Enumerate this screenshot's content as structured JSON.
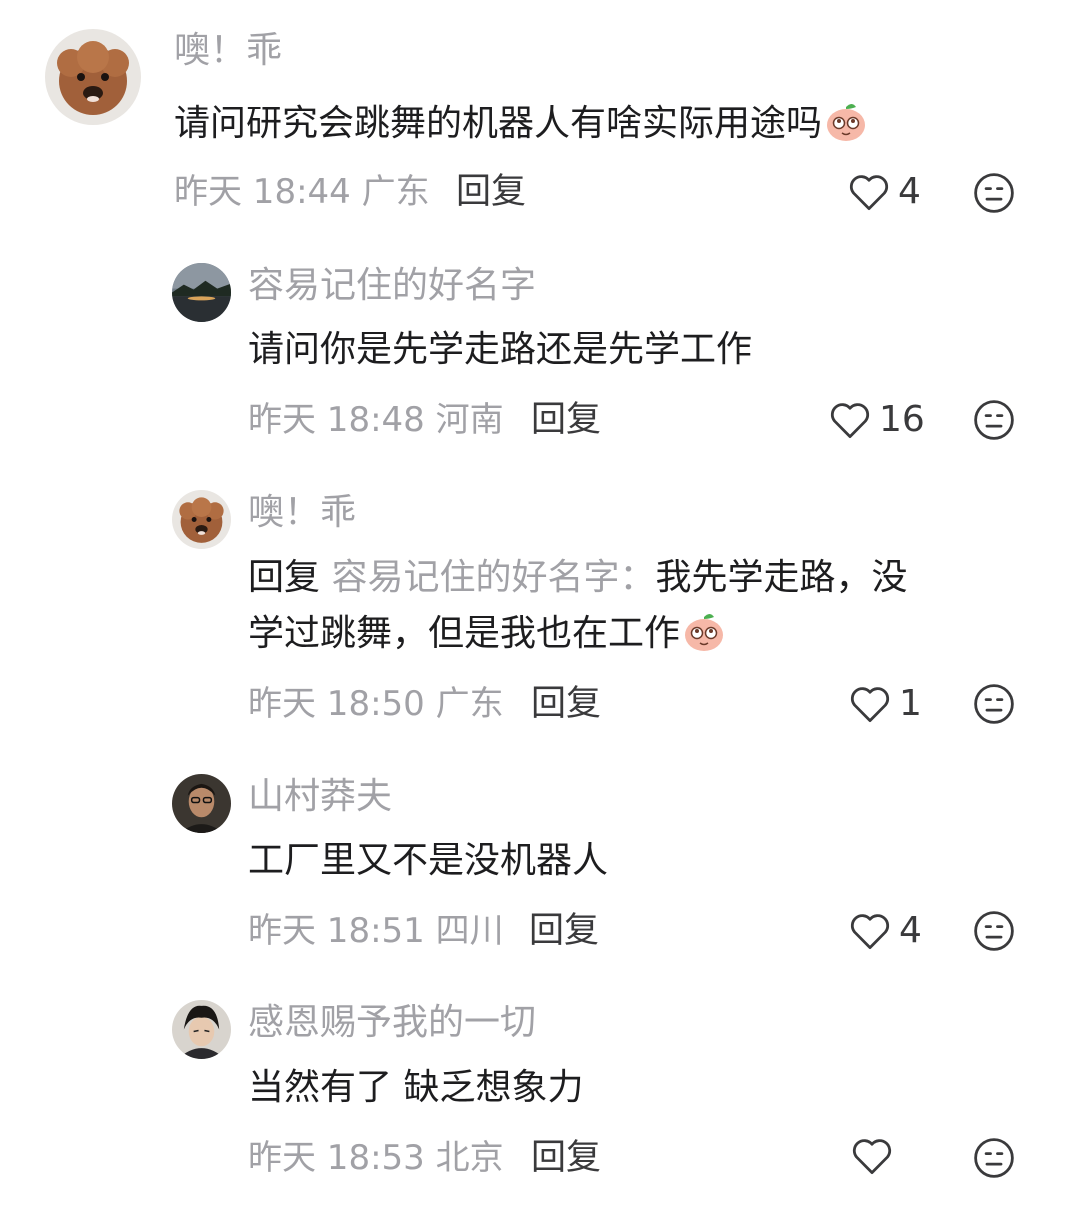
{
  "comments": [
    {
      "user": "噢！乖",
      "text": "请问研究会跳舞的机器人有啥实际用途吗",
      "has_emoji": true,
      "meta": "昨天 18:44 广东",
      "reply_label": "回复",
      "likes": "4"
    },
    {
      "user": "容易记住的好名字",
      "text": "请问你是先学走路还是先学工作",
      "meta": "昨天 18:48 河南",
      "reply_label": "回复",
      "likes": "16"
    },
    {
      "user": "噢！乖",
      "reply_prefix": "回复",
      "reply_target": "容易记住的好名字：",
      "text_line1": "我先学走路，没",
      "text_line2": "学过跳舞，但是我也在工作",
      "has_emoji": true,
      "meta": "昨天 18:50 广东",
      "reply_label": "回复",
      "likes": "1"
    },
    {
      "user": "山村莽夫",
      "text": "工厂里又不是没机器人",
      "meta": "昨天 18:51 四川",
      "reply_label": "回复",
      "likes": "4"
    },
    {
      "user": "感恩赐予我的一切",
      "text": "当然有了 缺乏想象力",
      "meta": "昨天 18:53 北京",
      "reply_label": "回复",
      "likes": ""
    }
  ],
  "icons": {
    "like": "heart-outline-icon",
    "dislike": "meh-face-icon",
    "emoji": "peach-emoji"
  }
}
